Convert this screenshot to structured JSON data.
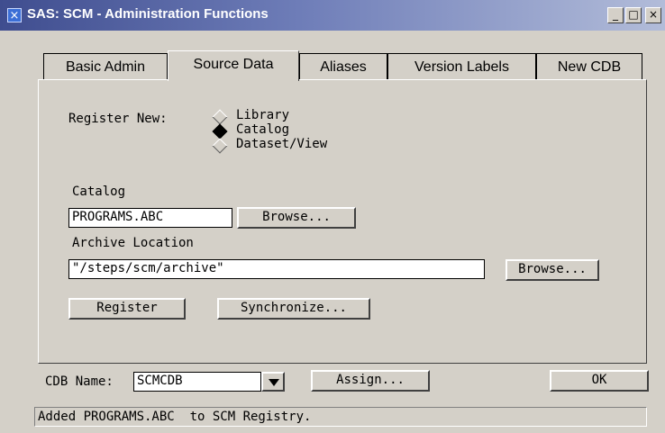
{
  "window": {
    "title": "SAS: SCM - Administration Functions",
    "sys_icon": "×",
    "minimize_icon": "_",
    "maximize_icon": "□",
    "close_icon": "×"
  },
  "tabs": [
    {
      "label": "Basic Admin",
      "active": false
    },
    {
      "label": "Source Data",
      "active": true
    },
    {
      "label": "Aliases",
      "active": false
    },
    {
      "label": "Version Labels",
      "active": false
    },
    {
      "label": "New CDB",
      "active": false
    }
  ],
  "source_data": {
    "register_label": "Register New:",
    "options": [
      {
        "label": "Library",
        "selected": false
      },
      {
        "label": "Catalog",
        "selected": true
      },
      {
        "label": "Dataset/View",
        "selected": false
      }
    ],
    "catalog_label": "Catalog",
    "catalog_value": "PROGRAMS.ABC",
    "browse_label": "Browse...",
    "archive_label": "Archive Location",
    "archive_value": "\"/steps/scm/archive\"",
    "browse2_label": "Browse...",
    "register_button": "Register",
    "synchronize_button": "Synchronize..."
  },
  "footer": {
    "cdb_label": "CDB Name:",
    "cdb_value": "SCMCDB",
    "assign_button": "Assign...",
    "ok_button": "OK"
  },
  "status_text": "Added PROGRAMS.ABC  to SCM Registry."
}
